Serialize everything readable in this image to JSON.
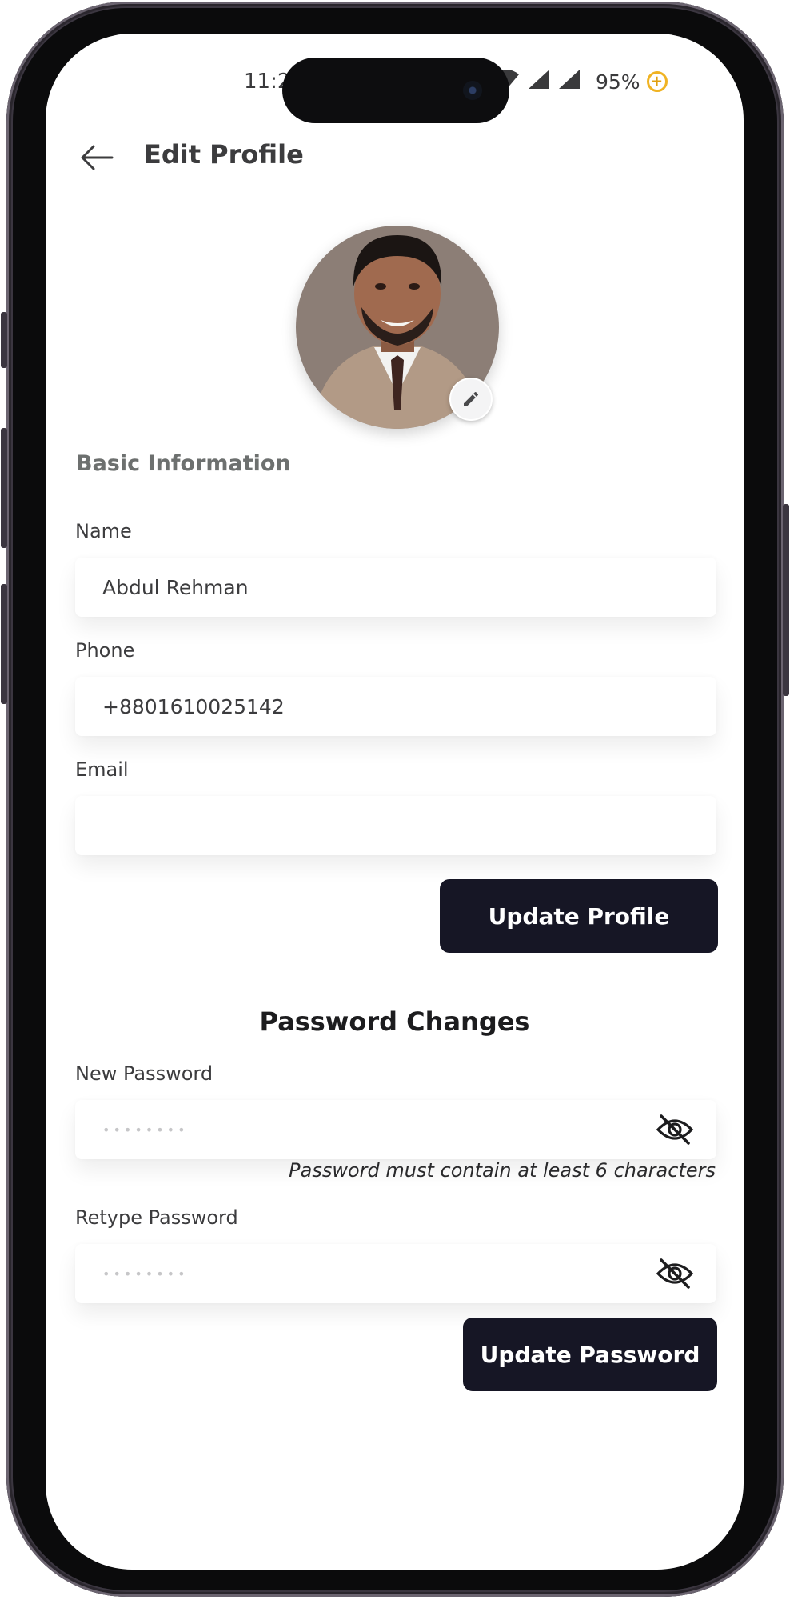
{
  "status_bar": {
    "time": "11:2",
    "battery_percent": "95%",
    "battery_badge": "+"
  },
  "header": {
    "title": "Edit Profile",
    "back_icon": "arrow-left-icon"
  },
  "profile": {
    "avatar_alt": "Profile photo",
    "edit_icon": "pencil-icon"
  },
  "basic_info": {
    "heading": "Basic Information",
    "name": {
      "label": "Name",
      "value": "Abdul Rehman"
    },
    "phone": {
      "label": "Phone",
      "value": "+8801610025142"
    },
    "email": {
      "label": "Email",
      "value": ""
    },
    "submit_label": "Update Profile"
  },
  "password": {
    "heading": "Password Changes",
    "new": {
      "label": "New Password",
      "placeholder": "••••••••"
    },
    "hint": "Password must contain at least 6 characters",
    "retype": {
      "label": "Retype Password",
      "placeholder": "••••••••"
    },
    "submit_label": "Update Password",
    "toggle_icon": "eye-off-icon"
  },
  "colors": {
    "primary_button": "#161625",
    "section_label": "#6d706f",
    "battery_accent": "#f0b323"
  }
}
